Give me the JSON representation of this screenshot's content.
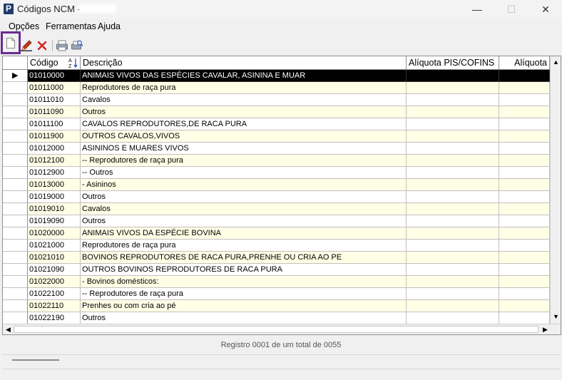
{
  "window": {
    "title": "Códigos NCM -",
    "app_icon_letter": "P",
    "minimize": "—",
    "maximize": "☐",
    "close": "✕"
  },
  "menu": [
    "Opções",
    "Ferramentas",
    "Ajuda"
  ],
  "toolbar": {
    "icons": [
      "new-document-icon",
      "edit-pencil-icon",
      "delete-x-icon",
      "print-icon",
      "print-preview-icon"
    ]
  },
  "grid": {
    "columns": [
      "Código",
      "Descrição",
      "Alíquota PIS/COFINS",
      "Alíquota"
    ],
    "rows": [
      {
        "codigo": "01010000",
        "descricao": "ANIMAIS VIVOS DAS ESPÉCIES CAVALAR, ASININA E MUAR"
      },
      {
        "codigo": "01011000",
        "descricao": "Reprodutores de raça pura"
      },
      {
        "codigo": "01011010",
        "descricao": "Cavalos"
      },
      {
        "codigo": "01011090",
        "descricao": "Outros"
      },
      {
        "codigo": "01011100",
        "descricao": "CAVALOS REPRODUTORES,DE RACA PURA"
      },
      {
        "codigo": "01011900",
        "descricao": "OUTROS CAVALOS,VIVOS"
      },
      {
        "codigo": "01012000",
        "descricao": "ASININOS E MUARES VIVOS"
      },
      {
        "codigo": "01012100",
        "descricao": "-- Reprodutores de raça pura"
      },
      {
        "codigo": "01012900",
        "descricao": "-- Outros"
      },
      {
        "codigo": "01013000",
        "descricao": "- Asininos"
      },
      {
        "codigo": "01019000",
        "descricao": "Outros"
      },
      {
        "codigo": "01019010",
        "descricao": "Cavalos"
      },
      {
        "codigo": "01019090",
        "descricao": "Outros"
      },
      {
        "codigo": "01020000",
        "descricao": "ANIMAIS VIVOS DA ESPÉCIE BOVINA"
      },
      {
        "codigo": "01021000",
        "descricao": "Reprodutores de raça pura"
      },
      {
        "codigo": "01021010",
        "descricao": "BOVINOS REPRODUTORES DE RACA PURA,PRENHE OU CRIA AO PE"
      },
      {
        "codigo": "01021090",
        "descricao": "OUTROS BOVINOS REPRODUTORES DE RACA PURA"
      },
      {
        "codigo": "01022000",
        "descricao": "- Bovinos domésticos:"
      },
      {
        "codigo": "01022100",
        "descricao": "-- Reprodutores de raça pura"
      },
      {
        "codigo": "01022110",
        "descricao": "Prenhes ou com cria ao pé"
      },
      {
        "codigo": "01022190",
        "descricao": "Outros"
      }
    ]
  },
  "status": "Registro 0001 de um total de 0055",
  "colors": {
    "selected_row_bg": "#000000",
    "selected_row_fg": "#ffffff",
    "alt_row_bg": "#ffffe6",
    "highlight_border": "#6a2c91",
    "delete_red": "#d22020"
  }
}
